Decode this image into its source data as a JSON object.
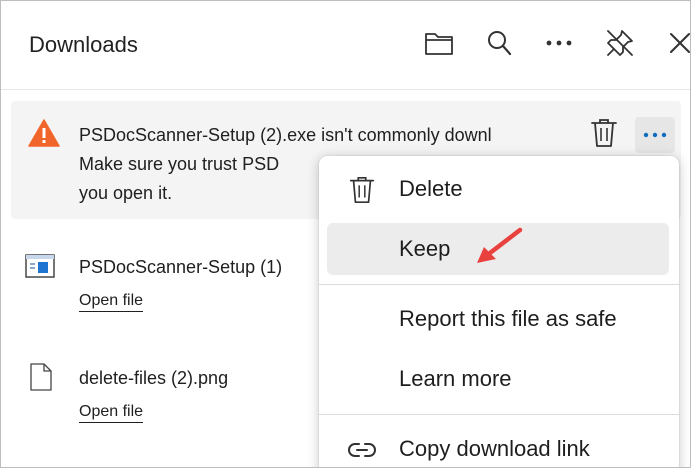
{
  "header": {
    "title": "Downloads"
  },
  "warning_item": {
    "line1": "PSDocScanner-Setup (2).exe isn't commonly downl",
    "line2": "Make sure you trust PSD",
    "line3": "you open it."
  },
  "downloads": [
    {
      "name": "PSDocScanner-Setup (1)",
      "action": "Open file"
    },
    {
      "name": "delete-files (2).png",
      "action": "Open file"
    }
  ],
  "context_menu": {
    "delete": "Delete",
    "keep": "Keep",
    "report_safe": "Report this file as safe",
    "learn_more": "Learn more",
    "copy_link": "Copy download link"
  },
  "colors": {
    "warning": "#f2652a",
    "accent": "#0f6cbd",
    "annotation_arrow": "#e8413e",
    "menu_hover": "#ececec"
  }
}
